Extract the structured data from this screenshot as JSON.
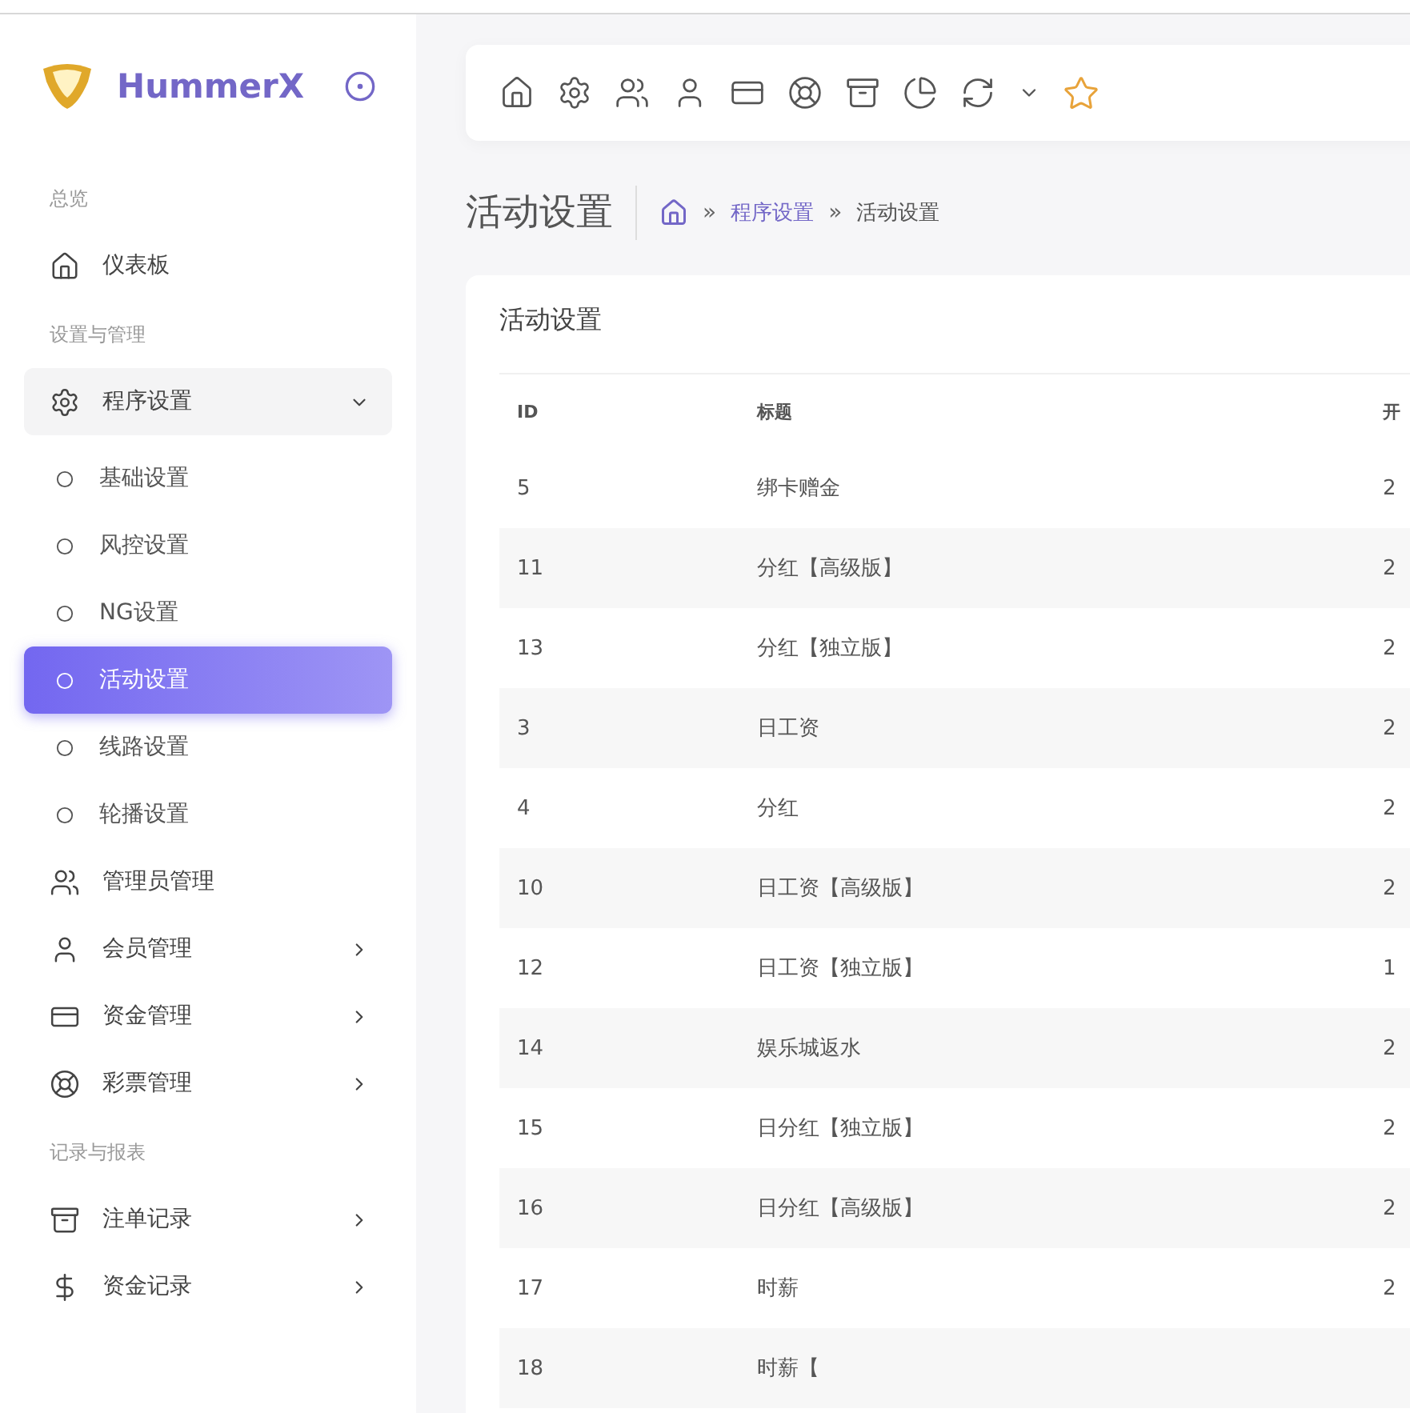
{
  "sidebar": {
    "brand": "HummerX",
    "sections": [
      {
        "heading": "总览",
        "items": [
          {
            "label": "仪表板"
          }
        ]
      },
      {
        "heading": "设置与管理",
        "items": [
          {
            "label": "程序设置",
            "expanded": true,
            "children": [
              {
                "label": "基础设置",
                "selected": false
              },
              {
                "label": "风控设置",
                "selected": false
              },
              {
                "label": "NG设置",
                "selected": false
              },
              {
                "label": "活动设置",
                "selected": true
              },
              {
                "label": "线路设置",
                "selected": false
              },
              {
                "label": "轮播设置",
                "selected": false
              }
            ]
          },
          {
            "label": "管理员管理"
          },
          {
            "label": "会员管理",
            "expanded": false
          },
          {
            "label": "资金管理",
            "expanded": false
          },
          {
            "label": "彩票管理",
            "expanded": false
          }
        ]
      },
      {
        "heading": "记录与报表",
        "items": [
          {
            "label": "注单记录",
            "expanded": false
          },
          {
            "label": "资金记录",
            "expanded": false
          }
        ]
      }
    ]
  },
  "page": {
    "title": "活动设置",
    "separator": "»",
    "breadcrumb": [
      {
        "label": "程序设置",
        "link": true
      },
      {
        "label": "活动设置",
        "link": false
      }
    ]
  },
  "card": {
    "title": "活动设置",
    "table": {
      "columns": [
        "ID",
        "标题",
        "开"
      ],
      "rows": [
        {
          "cells": [
            "5",
            "绑卡赠金",
            "2"
          ]
        },
        {
          "cells": [
            "11",
            "分红【高级版】",
            "2"
          ]
        },
        {
          "cells": [
            "13",
            "分红【独立版】",
            "2"
          ]
        },
        {
          "cells": [
            "3",
            "日工资",
            "2"
          ]
        },
        {
          "cells": [
            "4",
            "分红",
            "2"
          ]
        },
        {
          "cells": [
            "10",
            "日工资【高级版】",
            "2"
          ]
        },
        {
          "cells": [
            "12",
            "日工资【独立版】",
            "1"
          ]
        },
        {
          "cells": [
            "14",
            "娱乐城返水",
            "2"
          ]
        },
        {
          "cells": [
            "15",
            "日分红【独立版】",
            "2"
          ]
        },
        {
          "cells": [
            "16",
            "日分红【高级版】",
            "2"
          ]
        },
        {
          "cells": [
            "17",
            "时薪",
            "2"
          ]
        },
        {
          "cells": [
            "18",
            "时薪【",
            ""
          ]
        }
      ]
    }
  }
}
